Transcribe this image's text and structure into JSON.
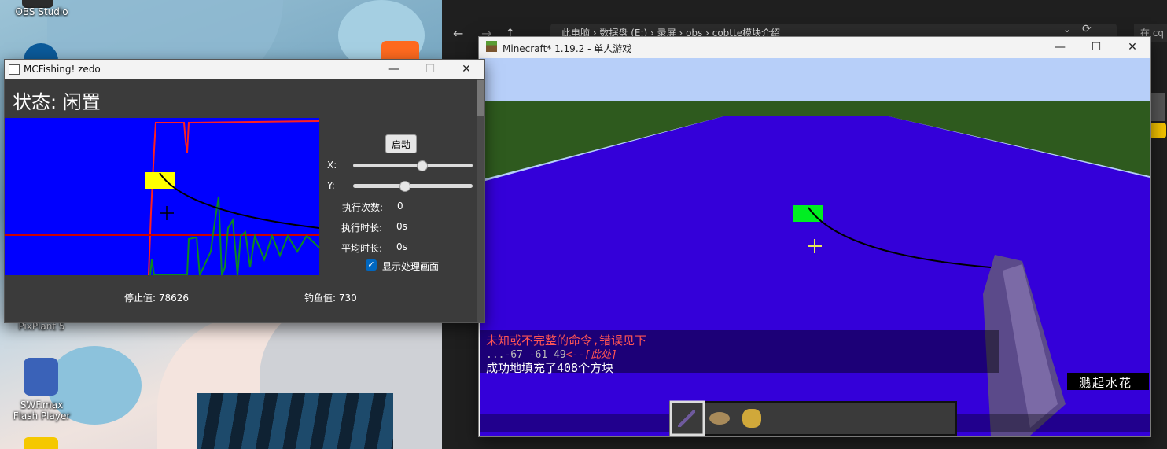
{
  "desktop": {
    "icons": [
      {
        "label": "OBS Studio"
      },
      {
        "label": "PixPlant 5"
      },
      {
        "label": "SWF.max\nFlash Player"
      }
    ]
  },
  "explorer": {
    "address": "此电脑 › 数据盘 (E:) › 录屏 › obs › cobtte模块介绍",
    "search_placeholder": "在 cq"
  },
  "minecraft": {
    "window_title": "Minecraft* 1.19.2 - 单人游戏",
    "chat": {
      "line1": "未知或不完整的命令,错误见下",
      "line2_prefix": "...-67 -61 49",
      "line2_marker": "<--[此处]",
      "line3": "成功地填充了408个方块"
    },
    "subtitle": "溅起水花",
    "colors": {
      "sky": "#b7cff9",
      "water": "#3400d9",
      "grass": "#2e5a1e",
      "chat_red": "#ff5555"
    }
  },
  "fishing": {
    "window_title": "MCFishing! zedo",
    "status": "状态: 闲置",
    "start_button": "启动",
    "x_label": "X:",
    "y_label": "Y:",
    "x_value": 0.58,
    "y_value": 0.42,
    "exec_count_label": "执行次数:",
    "exec_count_value": "0",
    "exec_time_label": "执行时长:",
    "exec_time_value": "0s",
    "avg_time_label": "平均时长:",
    "avg_time_value": "0s",
    "show_processing_label": "显示处理画面",
    "show_processing_checked": true,
    "stop_value_label": "停止值: 78626",
    "bite_value_label": "钓鱼值: 730"
  }
}
